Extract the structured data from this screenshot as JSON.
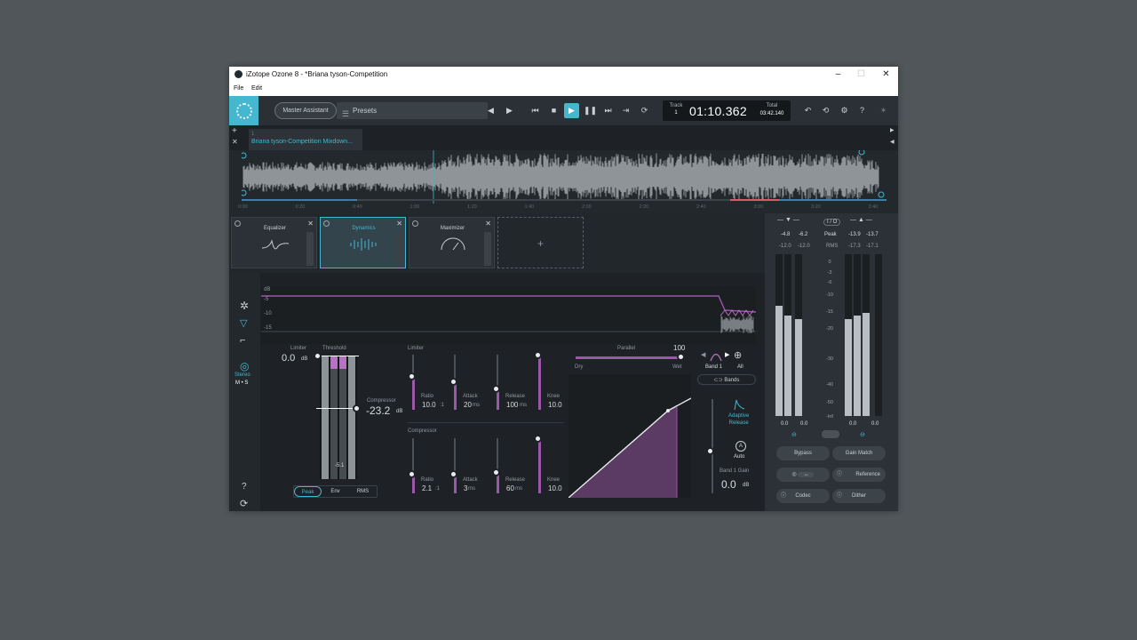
{
  "window": {
    "title": "iZotope Ozone 8 - *Briana tyson-Competition",
    "controls": {
      "minimize": "–",
      "maximize": "☐",
      "close": "✕"
    }
  },
  "menu": {
    "file": "File",
    "edit": "Edit"
  },
  "toolbar": {
    "master_assistant": "Master Assistant",
    "presets": "Presets",
    "track_label": "Track",
    "track_number": "1",
    "time": "01:10.362",
    "total_label": "Total",
    "total_time": "03:42.140"
  },
  "strip": {
    "track_tab": "Briana tyson-Competition Mixdown...",
    "tab_number": "1",
    "timeline_ticks": [
      "0:00",
      "0:20",
      "0:40",
      "1:00",
      "1:20",
      "1:40",
      "2:00",
      "2:20",
      "2:40",
      "3:00",
      "3:20",
      "3:40"
    ]
  },
  "modules": [
    {
      "name": "Equalizer",
      "selected": false
    },
    {
      "name": "Dynamics",
      "selected": true
    },
    {
      "name": "Maximizer",
      "selected": false
    }
  ],
  "add_module": "+",
  "graph": {
    "db_label": "dB",
    "ticks": [
      "-5",
      "-10",
      "-15"
    ]
  },
  "sidebar": {
    "stereo": "Stereo",
    "ms": "M • S",
    "help": "?"
  },
  "dynamics": {
    "limiter_label": "Limiter",
    "threshold_label": "Threshold",
    "limiter_threshold": "0.0",
    "limiter_unit": "dB",
    "compressor_label": "Compressor",
    "compressor_threshold": "-23.2",
    "compressor_unit": "dB",
    "meter_readout": "-5.1",
    "detection": [
      "Peak",
      "Env",
      "RMS"
    ],
    "limiter_section": "Limiter",
    "compressor_section": "Compressor",
    "limiter_params": [
      {
        "name": "Ratio",
        "value": "10.0",
        "unit": ":1"
      },
      {
        "name": "Attack",
        "value": "20",
        "unit": "ms"
      },
      {
        "name": "Release",
        "value": "100",
        "unit": "ms"
      },
      {
        "name": "Knee",
        "value": "10.0",
        "unit": ""
      }
    ],
    "compressor_params": [
      {
        "name": "Ratio",
        "value": "2.1",
        "unit": ":1"
      },
      {
        "name": "Attack",
        "value": "3",
        "unit": "ms"
      },
      {
        "name": "Release",
        "value": "60",
        "unit": "ms"
      },
      {
        "name": "Knee",
        "value": "10.0",
        "unit": ""
      }
    ],
    "parallel_label": "Parallel",
    "parallel_value": "100",
    "dry": "Dry",
    "wet": "Wet",
    "band": "Band 1",
    "all": "All",
    "bands_button": "Bands",
    "adaptive_release": "Adaptive\nRelease",
    "auto": "Auto",
    "band_gain_label": "Band 1 Gain",
    "band_gain_value": "0.0",
    "band_gain_unit": "dB"
  },
  "meters": {
    "io": "I / O",
    "peak": "Peak",
    "rms": "RMS",
    "in_peak": [
      "-4.8",
      "-6.2"
    ],
    "in_rms": [
      "-12.0",
      "-12.0"
    ],
    "out_peak": [
      "-13.9",
      "-13.7"
    ],
    "out_rms": [
      "-17.3",
      "-17.1"
    ],
    "scale": [
      "0",
      "-3",
      "-6",
      "-10",
      "-15",
      "-20",
      "-30",
      "-40",
      "-50",
      "-Inf"
    ],
    "in_bottom": [
      "0.0",
      "0.0"
    ],
    "out_bottom": [
      "0.0",
      "0.0"
    ],
    "bypass": "Bypass",
    "gain_match": "Gain Match",
    "reference": "Reference",
    "codec": "Codec",
    "dither": "Dither"
  }
}
